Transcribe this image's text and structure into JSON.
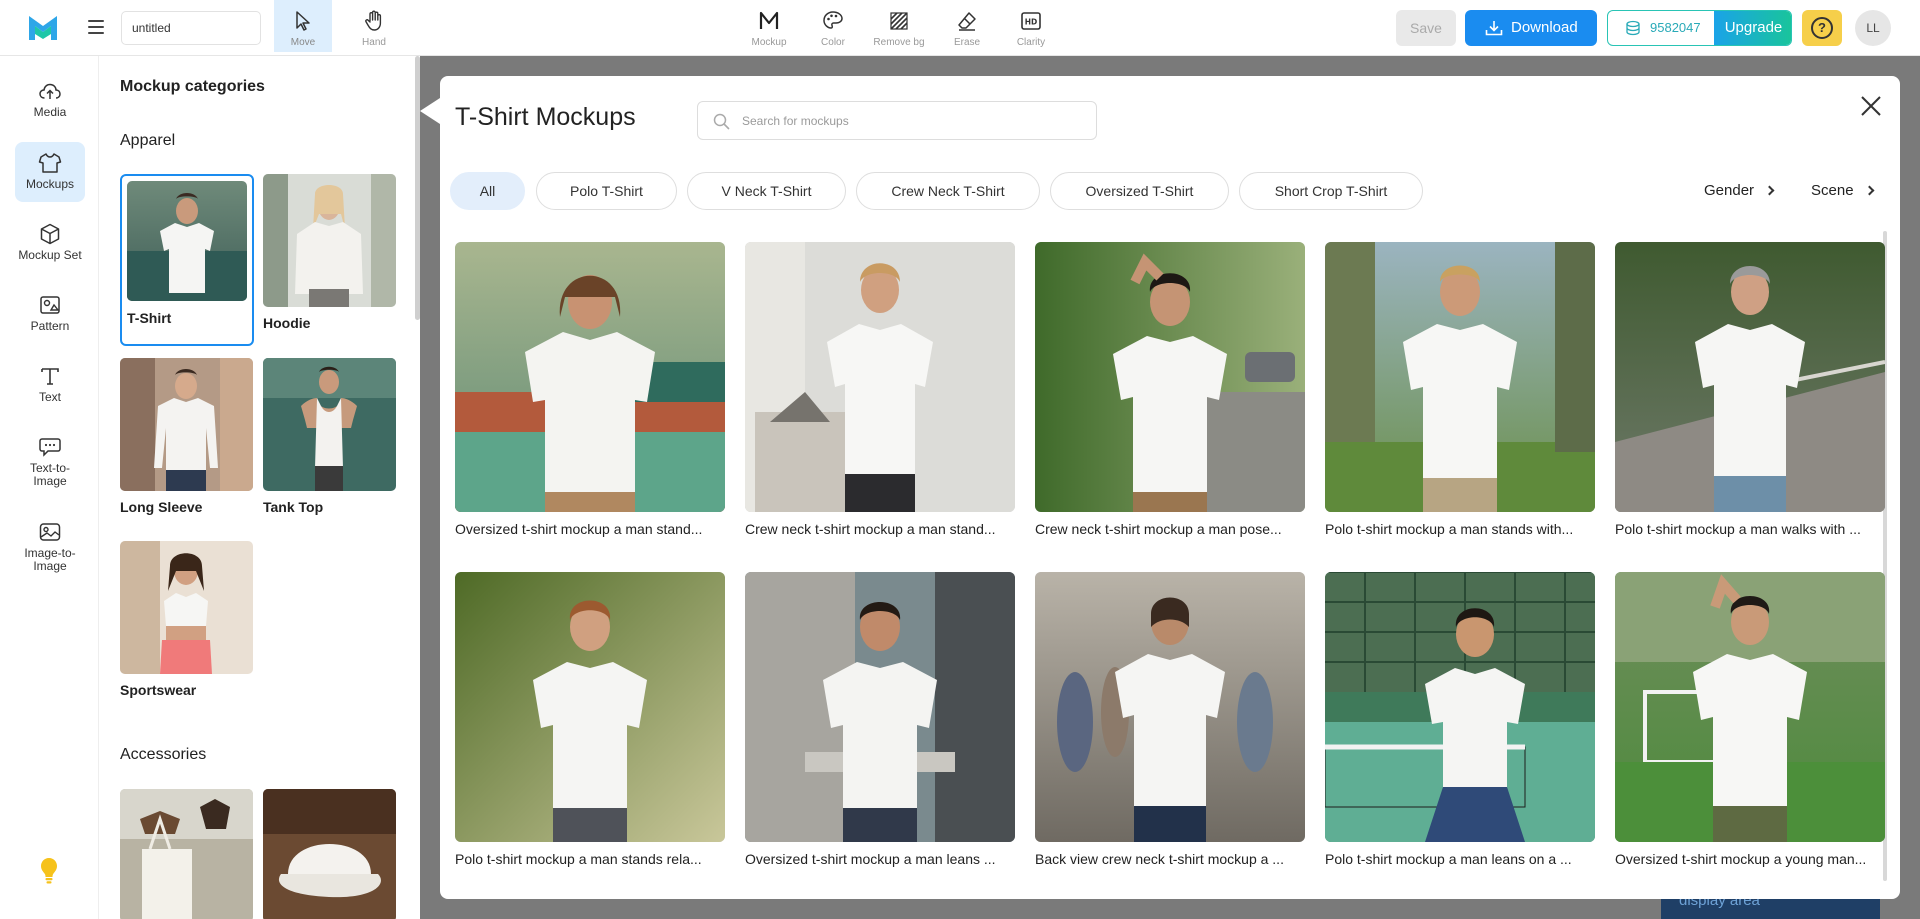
{
  "app": {
    "file_name": "untitled",
    "tools": [
      {
        "id": "move",
        "label": "Move",
        "icon": "cursor-icon"
      },
      {
        "id": "hand",
        "label": "Hand",
        "icon": "hand-icon"
      },
      {
        "id": "mockup",
        "label": "Mockup",
        "icon": "m-letter-icon"
      },
      {
        "id": "color",
        "label": "Color",
        "icon": "palette-icon"
      },
      {
        "id": "removebg",
        "label": "Remove bg",
        "icon": "remove-bg-icon"
      },
      {
        "id": "erase",
        "label": "Erase",
        "icon": "eraser-icon"
      },
      {
        "id": "clarity",
        "label": "Clarity",
        "icon": "hd-icon"
      }
    ],
    "save_label": "Save",
    "download_label": "Download",
    "credits": "9582047",
    "upgrade_label": "Upgrade",
    "avatar_initials": "LL"
  },
  "rail": {
    "items": [
      {
        "label": "Media",
        "icon": "cloud-upload-icon"
      },
      {
        "label": "Mockups",
        "icon": "tshirt-icon"
      },
      {
        "label": "Mockup Set",
        "icon": "cube-icon"
      },
      {
        "label": "Pattern",
        "icon": "pattern-icon"
      },
      {
        "label": "Text",
        "icon": "text-icon"
      },
      {
        "label": "Text-to-Image",
        "icon": "text-to-image-icon"
      },
      {
        "label": "Image-to-Image",
        "icon": "image-to-image-icon"
      }
    ]
  },
  "categories": {
    "title": "Mockup categories",
    "apparel_heading": "Apparel",
    "apparel": [
      {
        "name": "T-Shirt"
      },
      {
        "name": "Hoodie"
      },
      {
        "name": "Long Sleeve"
      },
      {
        "name": "Tank Top"
      },
      {
        "name": "Sportswear"
      }
    ],
    "accessories_heading": "Accessories"
  },
  "modal": {
    "title": "T-Shirt Mockups",
    "search_placeholder": "Search for mockups",
    "chips": [
      "All",
      "Polo T-Shirt",
      "V Neck T-Shirt",
      "Crew Neck T-Shirt",
      "Oversized T-Shirt",
      "Short Crop T-Shirt"
    ],
    "filters": [
      "Gender",
      "Scene"
    ],
    "cards": [
      "Oversized t-shirt mockup a man stand...",
      "Crew neck t-shirt mockup a man stand...",
      "Crew neck t-shirt mockup a man pose...",
      "Polo t-shirt mockup a man stands with...",
      "Polo t-shirt mockup a man walks with ...",
      "Polo t-shirt mockup a man stands rela...",
      "Oversized t-shirt mockup a man leans ...",
      "Back view crew neck t-shirt mockup a ...",
      "Polo t-shirt mockup a man leans on a ...",
      "Oversized t-shirt mockup a young man..."
    ]
  },
  "canvas": {
    "display_area_label": "display area"
  },
  "colors": {
    "accent": "#1a8cf0",
    "upgrade_start": "#1aa3e8",
    "upgrade_end": "#19c59a",
    "help": "#f6cf4a",
    "active_bg": "#ddeefd"
  }
}
